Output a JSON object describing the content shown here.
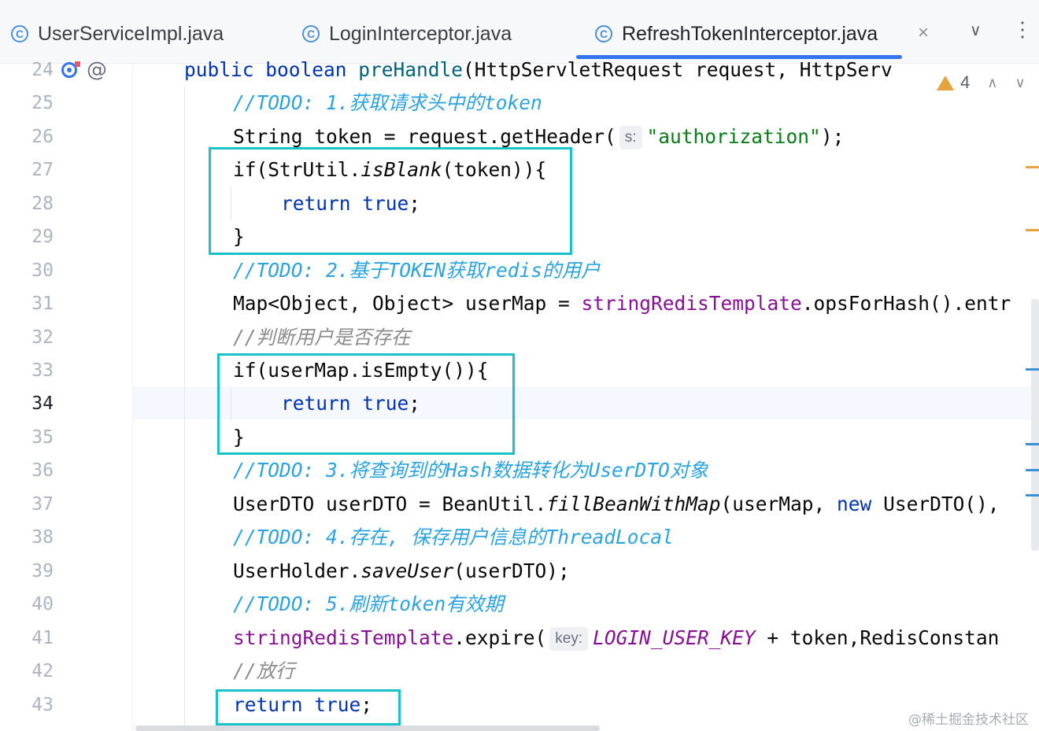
{
  "tabs": [
    {
      "label": "UserServiceImpl.java",
      "active": false
    },
    {
      "label": "LoginInterceptor.java",
      "active": false
    },
    {
      "label": "RefreshTokenInterceptor.java",
      "active": true
    }
  ],
  "tab_icon_glyph": "C",
  "tab_close_glyph": "×",
  "tab_menu_glyph": "∨",
  "tab_more_glyph": "⋮",
  "warnings": {
    "count": "4",
    "up": "∧",
    "down": "∨"
  },
  "gutter_at_glyph": "@",
  "current_line": "34",
  "line_numbers": [
    "24",
    "25",
    "26",
    "27",
    "28",
    "29",
    "30",
    "31",
    "32",
    "33",
    "34",
    "35",
    "36",
    "37",
    "38",
    "39",
    "40",
    "41",
    "42",
    "43"
  ],
  "code": {
    "l24": {
      "kw": "public boolean ",
      "name": "preHandle",
      "rest": "(HttpServletRequest request, HttpServ"
    },
    "l25": {
      "comment": "//TODO: 1.获取请求头中的token"
    },
    "l26": {
      "a": "String token = request.getHeader(",
      "hint": "s:",
      "str": "\"authorization\"",
      "b": ");"
    },
    "l27": {
      "a": "if(StrUtil.",
      "static": "isBlank",
      "b": "(token)){"
    },
    "l28": {
      "kw": "return true",
      "b": ";"
    },
    "l29": {
      "a": "}"
    },
    "l30": {
      "comment": "//TODO: 2.基于TOKEN获取redis的用户"
    },
    "l31": {
      "a": "Map<Object, Object> userMap = ",
      "field": "stringRedisTemplate",
      "b": ".opsForHash().entr"
    },
    "l32": {
      "comment": "//判断用户是否存在"
    },
    "l33": {
      "a": "if(userMap.isEmpty()){"
    },
    "l34": {
      "kw": "return true",
      "b": ";"
    },
    "l35": {
      "a": "}"
    },
    "l36": {
      "comment": "//TODO: 3.将查询到的Hash数据转化为UserDTO对象"
    },
    "l37": {
      "a": "UserDTO userDTO = BeanUtil.",
      "static": "fillBeanWithMap",
      "b": "(userMap, ",
      "kw": "new",
      "c": " UserDTO(),"
    },
    "l38": {
      "comment": "//TODO: 4.存在, 保存用户信息的ThreadLocal"
    },
    "l39": {
      "a": "UserHolder.",
      "static": "saveUser",
      "b": "(userDTO);"
    },
    "l40": {
      "comment": "//TODO: 5.刷新token有效期"
    },
    "l41": {
      "field": "stringRedisTemplate",
      "a": ".expire(",
      "hint": "key:",
      "const": "LOGIN_USER_KEY",
      "b": " + token,RedisConstan"
    },
    "l42": {
      "comment": "//放行"
    },
    "l43": {
      "kw": "return true",
      "b": ";"
    }
  },
  "watermark": "@稀土掘金技术社区",
  "colors": {
    "highlight_box": "#19c1c9",
    "todo": "#2aa3e0",
    "keyword": "#0033b3",
    "string": "#067d17",
    "field": "#871094"
  }
}
